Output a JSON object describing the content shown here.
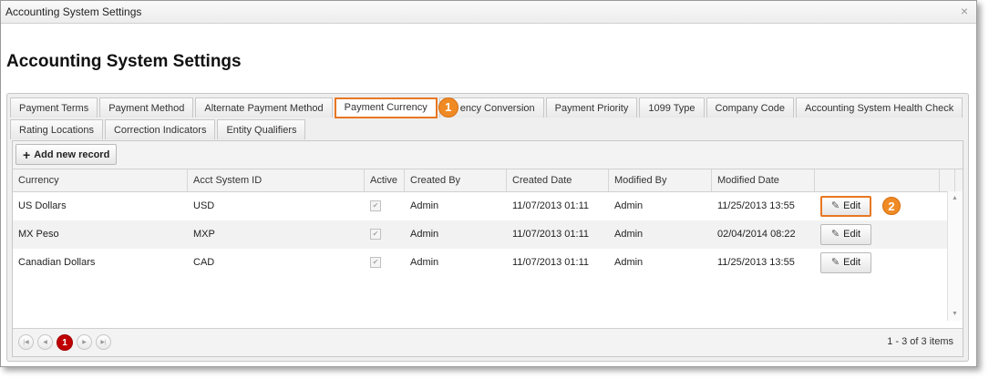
{
  "window": {
    "title": "Accounting System Settings",
    "close_glyph": "×"
  },
  "page": {
    "title": "Accounting System Settings"
  },
  "tabs_row1": [
    {
      "label": "Payment Terms"
    },
    {
      "label": "Payment Method"
    },
    {
      "label": "Alternate Payment Method"
    },
    {
      "label": "Payment Currency",
      "active": true
    },
    {
      "label": "ency Conversion"
    },
    {
      "label": "Payment Priority"
    },
    {
      "label": "1099 Type"
    },
    {
      "label": "Company Code"
    },
    {
      "label": "Accounting System Health Check"
    }
  ],
  "tabs_row2": [
    {
      "label": "Rating Locations"
    },
    {
      "label": "Correction Indicators"
    },
    {
      "label": "Entity Qualifiers"
    }
  ],
  "callouts": {
    "one": "1",
    "two": "2"
  },
  "toolbar": {
    "add_label": "Add new record",
    "add_icon": "plus-icon"
  },
  "grid": {
    "headers": [
      "Currency",
      "Acct System ID",
      "Active",
      "Created By",
      "Created Date",
      "Modified By",
      "Modified Date",
      ""
    ],
    "rows": [
      {
        "currency": "US Dollars",
        "acct_id": "USD",
        "active": true,
        "created_by": "Admin",
        "created_date": "11/07/2013 01:11",
        "modified_by": "Admin",
        "modified_date": "11/25/2013 13:55",
        "edit_label": "Edit"
      },
      {
        "currency": "MX Peso",
        "acct_id": "MXP",
        "active": true,
        "created_by": "Admin",
        "created_date": "11/07/2013 01:11",
        "modified_by": "Admin",
        "modified_date": "02/04/2014 08:22",
        "edit_label": "Edit"
      },
      {
        "currency": "Canadian Dollars",
        "acct_id": "CAD",
        "active": true,
        "created_by": "Admin",
        "created_date": "11/07/2013 01:11",
        "modified_by": "Admin",
        "modified_date": "11/25/2013 13:55",
        "edit_label": "Edit"
      }
    ]
  },
  "pager": {
    "current_page": "1",
    "info": "1 - 3 of 3 items"
  },
  "colors": {
    "accent": "#e87722",
    "callout": "#f08a24",
    "current_page": "#c00000"
  }
}
